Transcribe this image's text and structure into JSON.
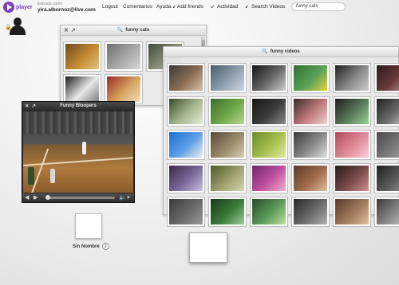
{
  "app": {
    "logo_text": "player"
  },
  "account": {
    "label": "Entrada como",
    "email": "yira.albornoz@live.com"
  },
  "menu": {
    "logout": "Logout",
    "comentarios": "Comentarios",
    "ayuda": "Ayuda",
    "addfriends": "Add friends",
    "actividad": "Actividad",
    "search_videos": "Search Videos"
  },
  "search": {
    "value": "funny cats"
  },
  "panels": {
    "cats": {
      "title": "funny cats"
    },
    "videos": {
      "title": "funny videos"
    },
    "player": {
      "title": "Funny Bloopers"
    }
  },
  "colors": {
    "accent": "#7b3fb8",
    "panel_bg": "#e8e8e8",
    "player_bg": "#2a2a2a"
  },
  "icons": {
    "search": "magnifier",
    "lock": "lock",
    "close": "x",
    "expand": "diagonal-arrows",
    "play": "triangle",
    "volume": "speaker",
    "menu": "down-triangle"
  },
  "desktop": {
    "item_label": "Sin Nombre",
    "item_count": "2"
  },
  "cats_thumbs": [
    {
      "palette": [
        "#6b4a1e",
        "#c48a34",
        "#e7c27a"
      ]
    },
    {
      "palette": [
        "#6f6f6f",
        "#a8a8a8",
        "#d8d8d8"
      ]
    },
    {
      "palette": [
        "#3f4a3f",
        "#8b8f7a",
        "#c9c7b8"
      ]
    },
    {
      "palette": [
        "#1b1b1b",
        "#e9e9e9",
        "#7c7c7c"
      ]
    },
    {
      "palette": [
        "#9a2a2a",
        "#d6a35c",
        "#f2e1c0"
      ]
    }
  ],
  "videos_thumbs": [
    {
      "palette": [
        "#3a3a3a",
        "#8c6e52",
        "#d6c4b0"
      ]
    },
    {
      "palette": [
        "#4a5a6a",
        "#8fa0b0",
        "#d0d8e0"
      ]
    },
    {
      "palette": [
        "#141414",
        "#6a6a6a",
        "#d0d0d0"
      ]
    },
    {
      "palette": [
        "#2f6f2f",
        "#5aa05a",
        "#e6d23a"
      ]
    },
    {
      "palette": [
        "#1e1e1e",
        "#8a8a8a",
        "#cfcfcf"
      ]
    },
    {
      "palette": [
        "#2a1a1a",
        "#6a3a3a",
        "#bfa0a0"
      ]
    },
    {
      "palette": [
        "#3a4a2a",
        "#a7b890",
        "#e8ecd8"
      ]
    },
    {
      "palette": [
        "#3c6e2a",
        "#6fa84a",
        "#b8d890"
      ]
    },
    {
      "palette": [
        "#151515",
        "#3c3c3c",
        "#8a8a8a"
      ]
    },
    {
      "palette": [
        "#3a2a2a",
        "#c07a7a",
        "#f0d0d0"
      ]
    },
    {
      "palette": [
        "#1d1d1d",
        "#5a7a5a",
        "#9ad09a"
      ]
    },
    {
      "palette": [
        "#202020",
        "#6b6b6b",
        "#d8d8d8"
      ]
    },
    {
      "palette": [
        "#1a6fd0",
        "#5fa0e6",
        "#f0f0f0"
      ]
    },
    {
      "palette": [
        "#5a4a3a",
        "#9a8a6a",
        "#d9cdb5"
      ]
    },
    {
      "palette": [
        "#6a8a2a",
        "#a7c050",
        "#e0ec9a"
      ]
    },
    {
      "palette": [
        "#3a3a3a",
        "#8a8a8a",
        "#e2e2e2"
      ]
    },
    {
      "palette": [
        "#b04a5a",
        "#e08a98",
        "#f6d0d8"
      ]
    },
    {
      "palette": [
        "#4a4a4a",
        "#7a7a7a",
        "#b0b0b0"
      ]
    },
    {
      "palette": [
        "#3a2a4a",
        "#7a6a9a",
        "#c9c0e0"
      ]
    },
    {
      "palette": [
        "#4a5a2a",
        "#a0a070",
        "#d6d6b0"
      ]
    },
    {
      "palette": [
        "#6a2a6a",
        "#c050a0",
        "#f0b0d0"
      ]
    },
    {
      "palette": [
        "#5a3a2a",
        "#a06a4a",
        "#e0c0a0"
      ]
    },
    {
      "palette": [
        "#2a1a1a",
        "#7a4a4a",
        "#d09090"
      ]
    },
    {
      "palette": [
        "#202020",
        "#5a5a5a",
        "#a0a0a0"
      ]
    },
    {
      "palette": [
        "#3a3a3a",
        "#6a6a6a",
        "#9a9a9a"
      ]
    },
    {
      "palette": [
        "#1a3a1a",
        "#3a7a3a",
        "#9ad09a"
      ]
    },
    {
      "palette": [
        "#2a4a2a",
        "#5a9a5a",
        "#c0e0a0"
      ]
    },
    {
      "palette": [
        "#2a2a2a",
        "#6a6a6a",
        "#b0b0b0"
      ]
    },
    {
      "palette": [
        "#5a3a2a",
        "#a07a5a",
        "#e0c0a0"
      ]
    },
    {
      "palette": [
        "#3a3a3a",
        "#8a8a8a",
        "#cfcfcf"
      ]
    }
  ],
  "desktop_thumb": {
    "palette": [
      "#1a6fd0",
      "#5fa0e6",
      "#f0f0f0"
    ]
  },
  "dragging_thumb": {
    "palette": [
      "#1a6fd0",
      "#5fa0e6",
      "#f0f0f0"
    ]
  }
}
